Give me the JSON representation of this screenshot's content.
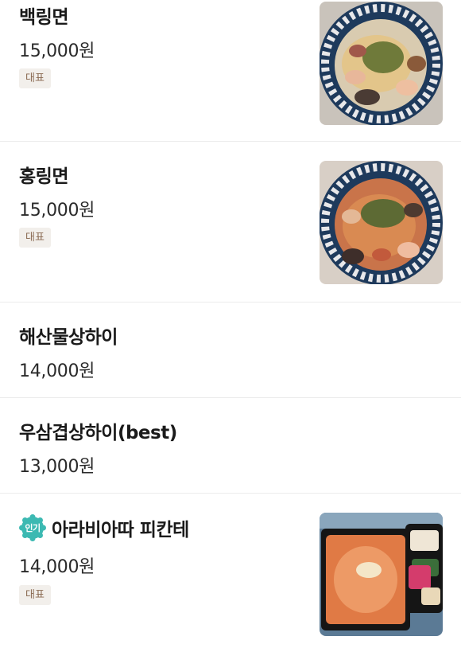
{
  "menu": {
    "items": [
      {
        "name": "백링면",
        "price": "15,000원",
        "tag": "대표",
        "image": "seafood-white-pasta-photo"
      },
      {
        "name": "홍링면",
        "price": "15,000원",
        "tag": "대표",
        "image": "seafood-red-pasta-photo"
      },
      {
        "name": "해산물상하이",
        "price": "14,000원"
      },
      {
        "name": "우삼겹상하이(best)",
        "price": "13,000원"
      },
      {
        "badge": "인기",
        "name": "아라비아따 피칸테",
        "price": "14,000원",
        "tag": "대표",
        "image": "arrabbiata-bento-photo"
      }
    ]
  },
  "colors": {
    "badge": "#3cb9b2",
    "tag_bg": "#f2efeb",
    "tag_text": "#8a6a52",
    "divider": "#ececec"
  }
}
